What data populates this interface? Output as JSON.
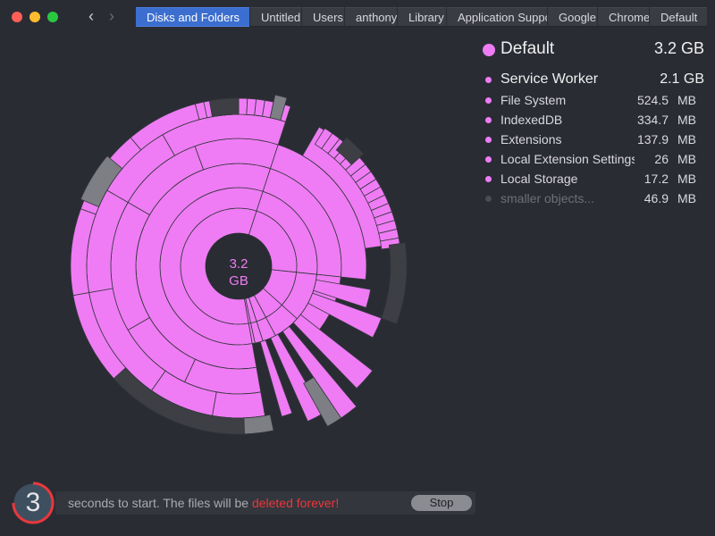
{
  "window": {
    "traffic_lights": {
      "close": "#fe5f57",
      "minimize": "#febc2e",
      "zoom": "#28c840"
    },
    "nav": {
      "back_icon": "chevron-left-icon",
      "forward_icon": "chevron-right-icon",
      "back_glyph": "‹",
      "forward_glyph": "›"
    }
  },
  "breadcrumb": [
    {
      "label": "Disks and Folders",
      "active": true
    },
    {
      "label": "Untitled"
    },
    {
      "label": "Users"
    },
    {
      "label": "anthony"
    },
    {
      "label": "Library"
    },
    {
      "label": "Application Support"
    },
    {
      "label": "Google"
    },
    {
      "label": "Chrome"
    },
    {
      "label": "Default"
    }
  ],
  "sunburst": {
    "center_value": "3.2",
    "center_unit": "GB",
    "colors": {
      "segment": "#ef7cf4",
      "hidden": "#3d3f45",
      "small": "#7d7f84",
      "stroke": "#34363d",
      "hole": "#2a2c34"
    }
  },
  "detail": {
    "name": "Default",
    "size": "3.2 GB",
    "accent": "#ef7cf4",
    "items": [
      {
        "name": "Service Worker",
        "size": "2.1 GB"
      },
      {
        "name": "File System",
        "size": "524.5",
        "unit": "MB"
      },
      {
        "name": "IndexedDB",
        "size": "334.7",
        "unit": "MB"
      },
      {
        "name": "Extensions",
        "size": "137.9",
        "unit": "MB"
      },
      {
        "name": "Local Extension Settings",
        "size": "26",
        "unit": "MB"
      },
      {
        "name": "Local Storage",
        "size": "17.2",
        "unit": "MB"
      },
      {
        "name": "smaller objects...",
        "size": "46.9",
        "unit": "MB",
        "muted": true
      }
    ]
  },
  "footer": {
    "countdown": "3",
    "message_prefix": "seconds to start. The files will be ",
    "message_warning": "deleted forever!",
    "warning_color": "#e8383c",
    "stop_label": "Stop"
  }
}
